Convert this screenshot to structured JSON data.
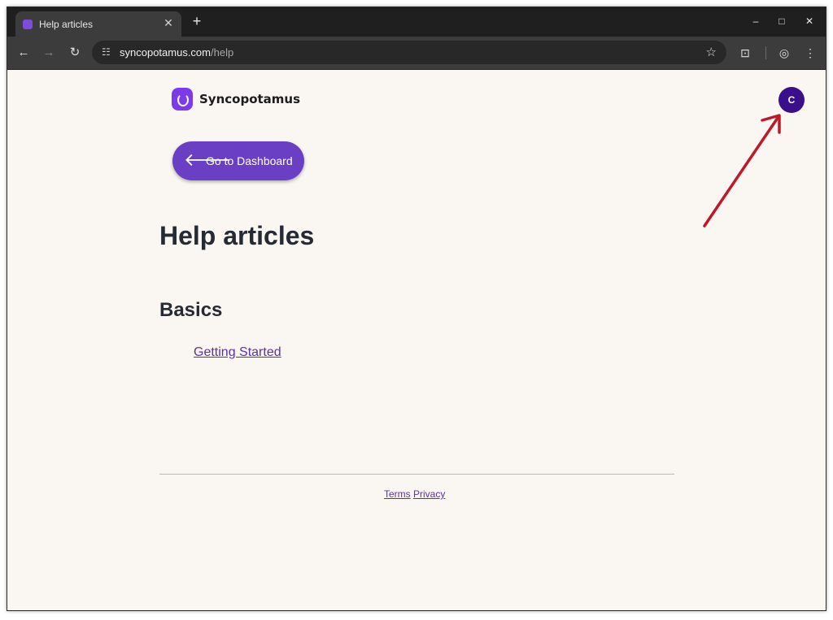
{
  "browser": {
    "tab_title": "Help articles",
    "tab_close": "✕",
    "new_tab": "+",
    "url_host": "syncopotamus.com",
    "url_path": "/help",
    "window_controls": {
      "minimize": "–",
      "maximize": "□",
      "close": "✕"
    }
  },
  "site": {
    "logo_text": "Syncopotamus",
    "avatar_initial": "C",
    "dashboard_button": "Go to Dashboard",
    "page_title": "Help articles",
    "section_title": "Basics",
    "articles": [
      "Getting Started"
    ],
    "footer": {
      "terms": "Terms",
      "privacy": "Privacy"
    }
  },
  "colors": {
    "brand_purple": "#6b3fc4",
    "avatar_bg": "#3b0f8c",
    "annotation_arrow": "#c0182b",
    "page_bg": "#faf7f3"
  }
}
